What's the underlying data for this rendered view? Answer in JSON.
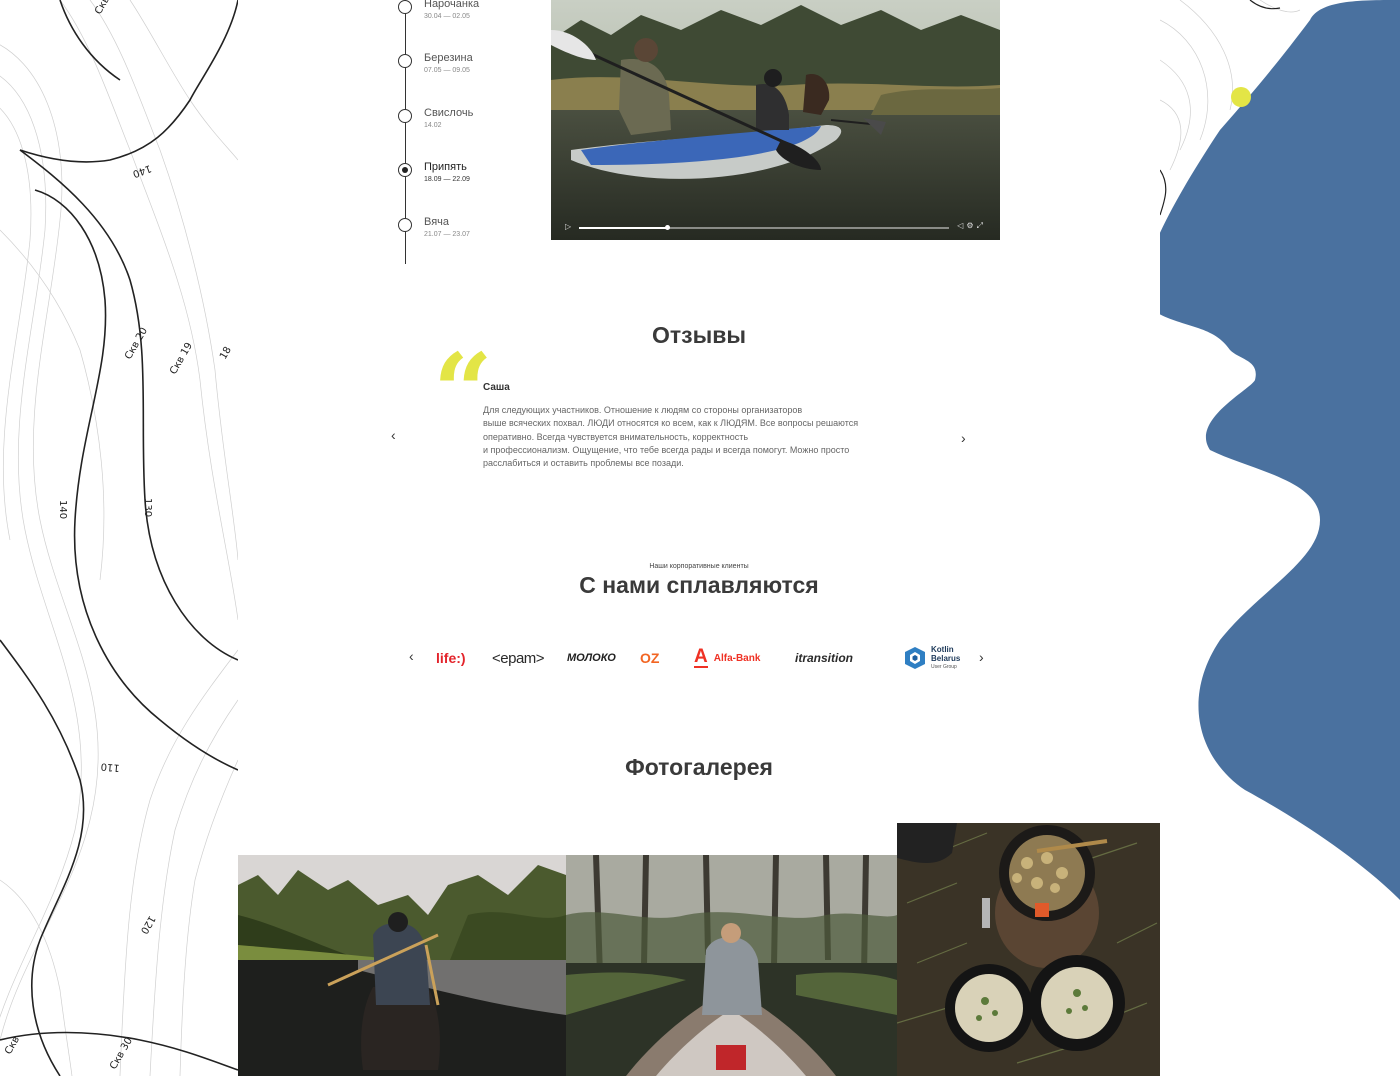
{
  "timeline": {
    "items": [
      {
        "name": "Нарочанка",
        "dates": "30.04 — 02.05",
        "active": false
      },
      {
        "name": "Березина",
        "dates": "07.05 — 09.05",
        "active": false
      },
      {
        "name": "Свислочь",
        "dates": "14.02",
        "active": false
      },
      {
        "name": "Припять",
        "dates": "18.09 — 22.09",
        "active": true
      },
      {
        "name": "Вяча",
        "dates": "21.07 — 23.07",
        "active": false
      }
    ]
  },
  "video": {
    "progress": 0.24
  },
  "reviews": {
    "title": "Отзывы",
    "author": "Саша",
    "text_lines": [
      "Для следующих участников. Отношение к людям со стороны организаторов",
      "выше всяческих похвал. ЛЮДИ относятся ко всем, как к ЛЮДЯМ. Все вопросы решаются",
      "оперативно. Всегда чувствуется внимательность, корректность",
      "и профессионализм. Ощущение, что тебе всегда рады и всегда помогут. Можно просто",
      "расслабиться и оставить проблемы все позади."
    ]
  },
  "clients": {
    "subtitle": "Наши корпоративные клиенты",
    "title": "С нами сплавляются",
    "logos": {
      "life": "life:)",
      "epam": "<epam>",
      "moloko": "МОЛОКО",
      "oz": "OZ",
      "alfa_letter": "А",
      "alfa": "Alfa-Bank",
      "itransition": "itransition",
      "kotlin_line1": "Kotlin",
      "kotlin_line2": "Belarus",
      "kotlin_line3": "User Group"
    }
  },
  "gallery": {
    "title": "Фотогалерея"
  },
  "colors": {
    "accent_yellow": "#e3e546",
    "blob_blue": "#4a719f",
    "alfa_red": "#ef3124",
    "life_red": "#e3242b",
    "oz_orange": "#f26522",
    "epam_blue": "#39c2d7"
  },
  "icons": {
    "prev": "chevron-left-icon",
    "next": "chevron-right-icon",
    "quote": "quote-icon"
  }
}
